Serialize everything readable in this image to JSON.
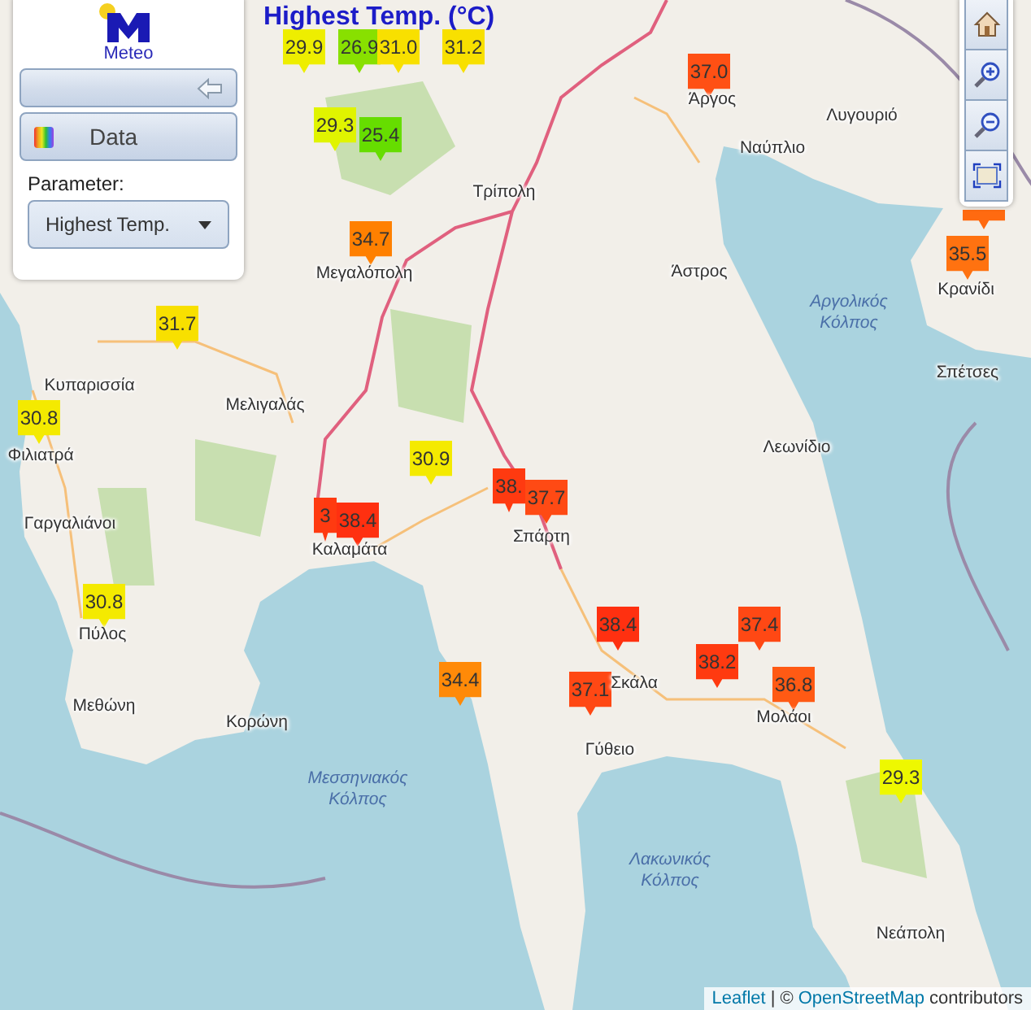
{
  "title": "Highest Temp. (°C)",
  "panel": {
    "logo_text": "Meteo",
    "data_button": "Data",
    "parameter_label": "Parameter:",
    "parameter_value": "Highest Temp."
  },
  "markers": [
    {
      "value": "29.9",
      "color": "#eeee00"
    },
    {
      "value": "26.9",
      "color": "#88e000"
    },
    {
      "value": "31.0",
      "color": "#f8e000"
    },
    {
      "value": "31.2",
      "color": "#f8e000"
    },
    {
      "value": "37.0",
      "color": "#ff5014"
    },
    {
      "value": "29.3",
      "color": "#e0f400"
    },
    {
      "value": "25.4",
      "color": "#66dd00"
    },
    {
      "color": "#ff6a10"
    },
    {
      "value": "34.7",
      "color": "#ff8000"
    },
    {
      "value": "35.5",
      "color": "#ff7210"
    },
    {
      "value": "31.7",
      "color": "#f8e000"
    },
    {
      "value": "30.8",
      "color": "#f4ea00"
    },
    {
      "value": "30.9",
      "color": "#f4ea00"
    },
    {
      "value": "38.",
      "color": "#ff3a10"
    },
    {
      "value": "37.7",
      "color": "#ff4a14"
    },
    {
      "value": "3",
      "color": "#ff3a10"
    },
    {
      "value": "38.4",
      "color": "#ff3010"
    },
    {
      "value": "30.8",
      "color": "#f4ea00"
    },
    {
      "value": "38.4",
      "color": "#ff3010"
    },
    {
      "value": "37.4",
      "color": "#ff4814"
    },
    {
      "value": "38.2",
      "color": "#ff3a10"
    },
    {
      "value": "34.4",
      "color": "#ff8a08"
    },
    {
      "value": "37.1",
      "color": "#ff4814"
    },
    {
      "value": "36.8",
      "color": "#ff5a14"
    },
    {
      "value": "29.3",
      "color": "#eef800"
    }
  ],
  "places": [
    {
      "name": "Άργος",
      "kind": "town"
    },
    {
      "name": "Ναύπλιο",
      "kind": "town"
    },
    {
      "name": "Λυγουριό",
      "kind": "town"
    },
    {
      "name": "Τρίπολη",
      "kind": "town"
    },
    {
      "name": "Μεγαλόπολη",
      "kind": "town"
    },
    {
      "name": "Άστρος",
      "kind": "town"
    },
    {
      "name": "Αργολικός Κόλπος",
      "kind": "sea"
    },
    {
      "name": "Κρανίδι",
      "kind": "town"
    },
    {
      "name": "Σπέτσες",
      "kind": "town"
    },
    {
      "name": "Κυπαρισσία",
      "kind": "town"
    },
    {
      "name": "Μελιγαλάς",
      "kind": "town"
    },
    {
      "name": "Φιλιατρά",
      "kind": "town"
    },
    {
      "name": "Λεωνίδιο",
      "kind": "town"
    },
    {
      "name": "Γαργαλιάνοι",
      "kind": "town"
    },
    {
      "name": "Καλαμάτα",
      "kind": "town"
    },
    {
      "name": "Σπάρτη",
      "kind": "town"
    },
    {
      "name": "Πύλος",
      "kind": "town"
    },
    {
      "name": "Σκάλα",
      "kind": "town"
    },
    {
      "name": "Μολάοι",
      "kind": "town"
    },
    {
      "name": "Μεθώνη",
      "kind": "town"
    },
    {
      "name": "Κορώνη",
      "kind": "town"
    },
    {
      "name": "Γύθειο",
      "kind": "town"
    },
    {
      "name": "Μεσσηνιακός Κόλπος",
      "kind": "sea"
    },
    {
      "name": "Λακωνικός Κόλπος",
      "kind": "sea"
    },
    {
      "name": "Νεάπολη",
      "kind": "town"
    }
  ],
  "attribution": {
    "leaflet": "Leaflet",
    "separator": "| ©",
    "osm": "OpenStreetMap",
    "suffix": "contributors"
  }
}
